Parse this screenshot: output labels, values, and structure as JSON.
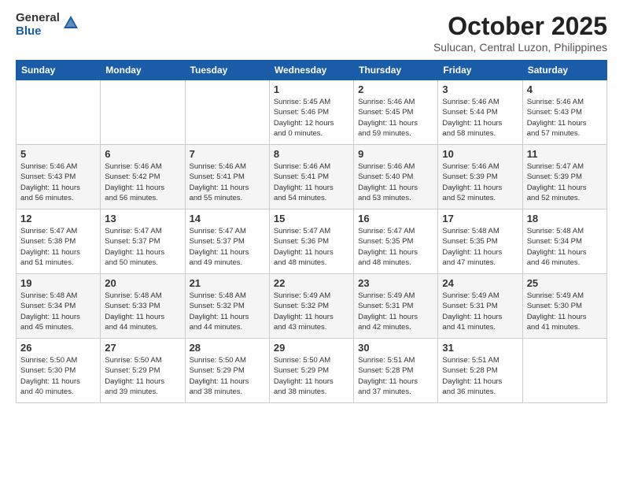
{
  "logo": {
    "general": "General",
    "blue": "Blue"
  },
  "header": {
    "month": "October 2025",
    "location": "Sulucan, Central Luzon, Philippines"
  },
  "weekdays": [
    "Sunday",
    "Monday",
    "Tuesday",
    "Wednesday",
    "Thursday",
    "Friday",
    "Saturday"
  ],
  "weeks": [
    [
      {
        "day": "",
        "info": ""
      },
      {
        "day": "",
        "info": ""
      },
      {
        "day": "",
        "info": ""
      },
      {
        "day": "1",
        "info": "Sunrise: 5:45 AM\nSunset: 5:46 PM\nDaylight: 12 hours\nand 0 minutes."
      },
      {
        "day": "2",
        "info": "Sunrise: 5:46 AM\nSunset: 5:45 PM\nDaylight: 11 hours\nand 59 minutes."
      },
      {
        "day": "3",
        "info": "Sunrise: 5:46 AM\nSunset: 5:44 PM\nDaylight: 11 hours\nand 58 minutes."
      },
      {
        "day": "4",
        "info": "Sunrise: 5:46 AM\nSunset: 5:43 PM\nDaylight: 11 hours\nand 57 minutes."
      }
    ],
    [
      {
        "day": "5",
        "info": "Sunrise: 5:46 AM\nSunset: 5:43 PM\nDaylight: 11 hours\nand 56 minutes."
      },
      {
        "day": "6",
        "info": "Sunrise: 5:46 AM\nSunset: 5:42 PM\nDaylight: 11 hours\nand 56 minutes."
      },
      {
        "day": "7",
        "info": "Sunrise: 5:46 AM\nSunset: 5:41 PM\nDaylight: 11 hours\nand 55 minutes."
      },
      {
        "day": "8",
        "info": "Sunrise: 5:46 AM\nSunset: 5:41 PM\nDaylight: 11 hours\nand 54 minutes."
      },
      {
        "day": "9",
        "info": "Sunrise: 5:46 AM\nSunset: 5:40 PM\nDaylight: 11 hours\nand 53 minutes."
      },
      {
        "day": "10",
        "info": "Sunrise: 5:46 AM\nSunset: 5:39 PM\nDaylight: 11 hours\nand 52 minutes."
      },
      {
        "day": "11",
        "info": "Sunrise: 5:47 AM\nSunset: 5:39 PM\nDaylight: 11 hours\nand 52 minutes."
      }
    ],
    [
      {
        "day": "12",
        "info": "Sunrise: 5:47 AM\nSunset: 5:38 PM\nDaylight: 11 hours\nand 51 minutes."
      },
      {
        "day": "13",
        "info": "Sunrise: 5:47 AM\nSunset: 5:37 PM\nDaylight: 11 hours\nand 50 minutes."
      },
      {
        "day": "14",
        "info": "Sunrise: 5:47 AM\nSunset: 5:37 PM\nDaylight: 11 hours\nand 49 minutes."
      },
      {
        "day": "15",
        "info": "Sunrise: 5:47 AM\nSunset: 5:36 PM\nDaylight: 11 hours\nand 48 minutes."
      },
      {
        "day": "16",
        "info": "Sunrise: 5:47 AM\nSunset: 5:35 PM\nDaylight: 11 hours\nand 48 minutes."
      },
      {
        "day": "17",
        "info": "Sunrise: 5:48 AM\nSunset: 5:35 PM\nDaylight: 11 hours\nand 47 minutes."
      },
      {
        "day": "18",
        "info": "Sunrise: 5:48 AM\nSunset: 5:34 PM\nDaylight: 11 hours\nand 46 minutes."
      }
    ],
    [
      {
        "day": "19",
        "info": "Sunrise: 5:48 AM\nSunset: 5:34 PM\nDaylight: 11 hours\nand 45 minutes."
      },
      {
        "day": "20",
        "info": "Sunrise: 5:48 AM\nSunset: 5:33 PM\nDaylight: 11 hours\nand 44 minutes."
      },
      {
        "day": "21",
        "info": "Sunrise: 5:48 AM\nSunset: 5:32 PM\nDaylight: 11 hours\nand 44 minutes."
      },
      {
        "day": "22",
        "info": "Sunrise: 5:49 AM\nSunset: 5:32 PM\nDaylight: 11 hours\nand 43 minutes."
      },
      {
        "day": "23",
        "info": "Sunrise: 5:49 AM\nSunset: 5:31 PM\nDaylight: 11 hours\nand 42 minutes."
      },
      {
        "day": "24",
        "info": "Sunrise: 5:49 AM\nSunset: 5:31 PM\nDaylight: 11 hours\nand 41 minutes."
      },
      {
        "day": "25",
        "info": "Sunrise: 5:49 AM\nSunset: 5:30 PM\nDaylight: 11 hours\nand 41 minutes."
      }
    ],
    [
      {
        "day": "26",
        "info": "Sunrise: 5:50 AM\nSunset: 5:30 PM\nDaylight: 11 hours\nand 40 minutes."
      },
      {
        "day": "27",
        "info": "Sunrise: 5:50 AM\nSunset: 5:29 PM\nDaylight: 11 hours\nand 39 minutes."
      },
      {
        "day": "28",
        "info": "Sunrise: 5:50 AM\nSunset: 5:29 PM\nDaylight: 11 hours\nand 38 minutes."
      },
      {
        "day": "29",
        "info": "Sunrise: 5:50 AM\nSunset: 5:29 PM\nDaylight: 11 hours\nand 38 minutes."
      },
      {
        "day": "30",
        "info": "Sunrise: 5:51 AM\nSunset: 5:28 PM\nDaylight: 11 hours\nand 37 minutes."
      },
      {
        "day": "31",
        "info": "Sunrise: 5:51 AM\nSunset: 5:28 PM\nDaylight: 11 hours\nand 36 minutes."
      },
      {
        "day": "",
        "info": ""
      }
    ]
  ]
}
